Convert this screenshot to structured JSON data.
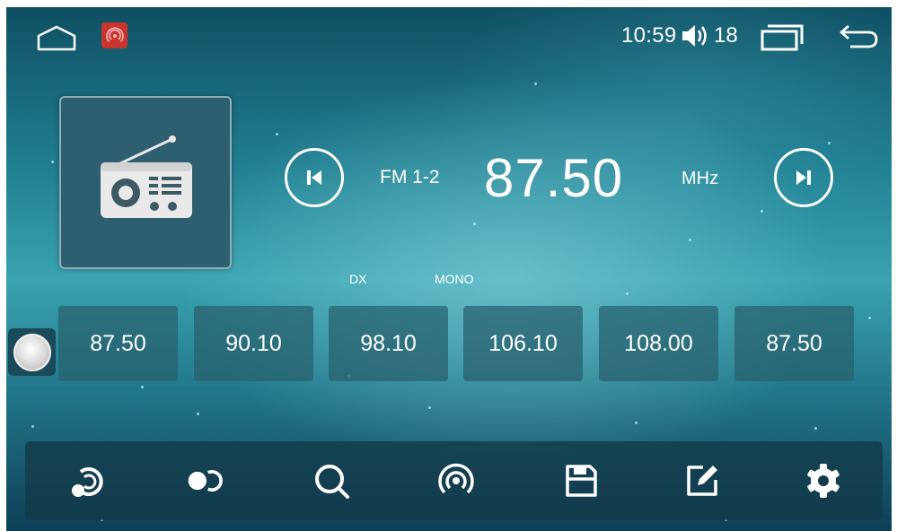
{
  "status_bar": {
    "time": "10:59",
    "volume_level": "18",
    "icons": [
      "home-icon",
      "radio-app-icon",
      "volume-icon",
      "recent-apps-icon",
      "back-icon"
    ]
  },
  "now_playing": {
    "band": "FM 1-2",
    "frequency": "87.50",
    "unit": "MHz",
    "flags": [
      "DX",
      "MONO"
    ]
  },
  "presets": [
    "87.50",
    "90.10",
    "98.10",
    "106.10",
    "108.00",
    "87.50"
  ],
  "toolbar": {
    "buttons": [
      "loop-scan-icon",
      "toggle-icon",
      "search-icon",
      "broadcast-icon",
      "save-icon",
      "edit-icon",
      "settings-icon"
    ]
  },
  "colors": {
    "panel": "#2d5f70",
    "preset_bg": "#285f6e",
    "toolbar_bg": "#143a4a",
    "text": "#ffffff"
  }
}
